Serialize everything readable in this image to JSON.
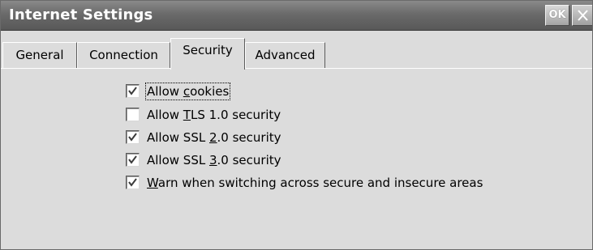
{
  "window": {
    "title": "Internet Settings",
    "ok_label": "OK",
    "close_icon": "close-icon"
  },
  "tabs": [
    {
      "label": "General",
      "active": false
    },
    {
      "label": "Connection",
      "active": false
    },
    {
      "label": "Security",
      "active": true
    },
    {
      "label": "Advanced",
      "active": false
    }
  ],
  "security": {
    "options": [
      {
        "pre": "Allow ",
        "mnemonic": "c",
        "post": "ookies",
        "checked": true,
        "focused": true
      },
      {
        "pre": "Allow ",
        "mnemonic": "T",
        "post": "LS 1.0 security",
        "checked": false,
        "focused": false
      },
      {
        "pre": "Allow SSL ",
        "mnemonic": "2",
        "post": ".0 security",
        "checked": true,
        "focused": false
      },
      {
        "pre": "Allow SSL ",
        "mnemonic": "3",
        "post": ".0 security",
        "checked": true,
        "focused": false
      },
      {
        "pre": "",
        "mnemonic": "W",
        "post": "arn when switching across secure and insecure areas",
        "checked": true,
        "focused": false
      }
    ]
  },
  "colors": {
    "titlebar": "#6a6a6a",
    "face": "#dcdcdc",
    "title_text": "#ffffff"
  }
}
